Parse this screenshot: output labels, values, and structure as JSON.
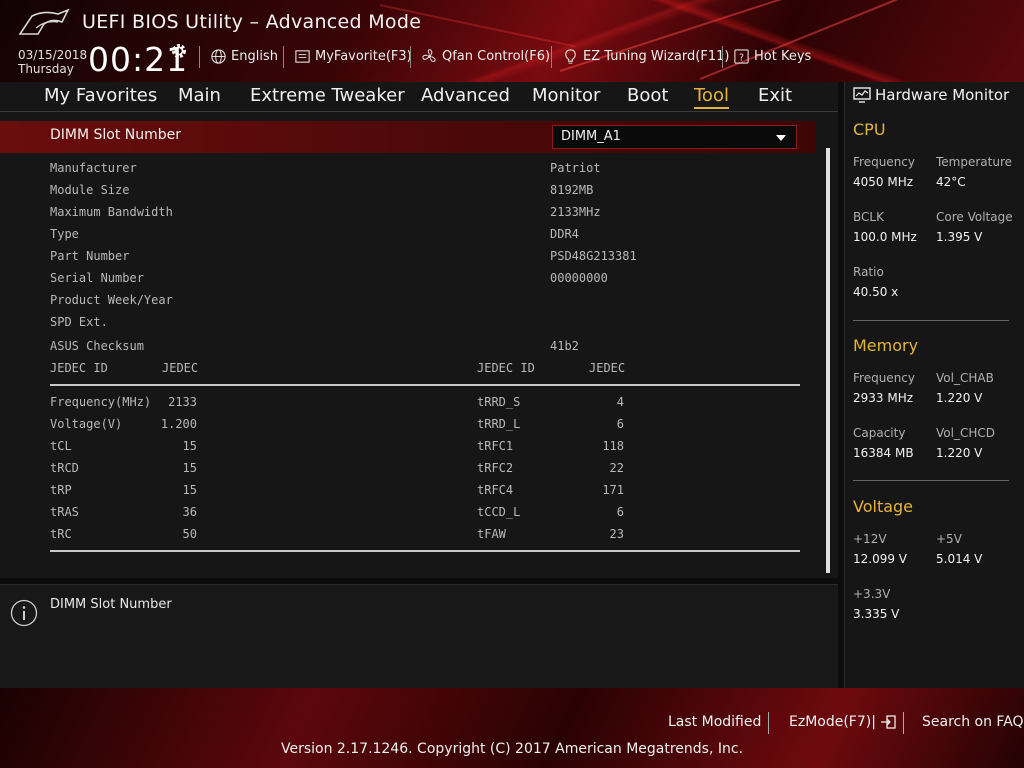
{
  "app": {
    "title": "UEFI BIOS Utility – Advanced Mode"
  },
  "clock": {
    "date": "03/15/2018",
    "day": "Thursday",
    "time": "00:21"
  },
  "toolbar": {
    "language": "English",
    "favorite": "MyFavorite(F3)",
    "qfan": "Qfan Control(F6)",
    "ez_tuning": "EZ Tuning Wizard(F11)",
    "hotkeys": "Hot Keys"
  },
  "menu": {
    "favorites": "My Favorites",
    "main": "Main",
    "extreme": "Extreme Tweaker",
    "advanced": "Advanced",
    "monitor": "Monitor",
    "boot": "Boot",
    "tool": "Tool",
    "exit": "Exit"
  },
  "slot": {
    "label": "DIMM Slot Number",
    "value": "DIMM_A1"
  },
  "info": [
    {
      "label": "Manufacturer",
      "value": "Patriot"
    },
    {
      "label": "Module Size",
      "value": "8192MB"
    },
    {
      "label": "Maximum Bandwidth",
      "value": "2133MHz"
    },
    {
      "label": "Type",
      "value": "DDR4"
    },
    {
      "label": "Part Number",
      "value": "PSD48G213381"
    },
    {
      "label": "Serial Number",
      "value": "00000000"
    },
    {
      "label": "Product Week/Year",
      "value": ""
    },
    {
      "label": "SPD Ext.",
      "value": ""
    },
    {
      "label": "ASUS Checksum",
      "value": "41b2"
    }
  ],
  "jedec": {
    "left_header": [
      "JEDEC ID",
      "JEDEC"
    ],
    "right_header": [
      "JEDEC ID",
      "JEDEC"
    ],
    "left": [
      {
        "name": "Frequency(MHz)",
        "value": "2133"
      },
      {
        "name": "Voltage(V)",
        "value": "1.200"
      },
      {
        "name": "tCL",
        "value": "15"
      },
      {
        "name": "tRCD",
        "value": "15"
      },
      {
        "name": "tRP",
        "value": "15"
      },
      {
        "name": "tRAS",
        "value": "36"
      },
      {
        "name": "tRC",
        "value": "50"
      }
    ],
    "right": [
      {
        "name": "tRRD_S",
        "value": "4"
      },
      {
        "name": "tRRD_L",
        "value": "6"
      },
      {
        "name": "tRFC1",
        "value": "118"
      },
      {
        "name": "tRFC2",
        "value": "22"
      },
      {
        "name": "tRFC4",
        "value": "171"
      },
      {
        "name": "tCCD_L",
        "value": "6"
      },
      {
        "name": "tFAW",
        "value": "23"
      }
    ]
  },
  "help": {
    "text": "DIMM Slot Number"
  },
  "hwmon": {
    "title": "Hardware Monitor",
    "cpu": {
      "title": "CPU",
      "frequency_label": "Frequency",
      "frequency": "4050 MHz",
      "temperature_label": "Temperature",
      "temperature": "42°C",
      "bclk_label": "BCLK",
      "bclk": "100.0 MHz",
      "core_voltage_label": "Core Voltage",
      "core_voltage": "1.395 V",
      "ratio_label": "Ratio",
      "ratio": "40.50 x"
    },
    "memory": {
      "title": "Memory",
      "frequency_label": "Frequency",
      "frequency": "2933 MHz",
      "vol_chab_label": "Vol_CHAB",
      "vol_chab": "1.220 V",
      "capacity_label": "Capacity",
      "capacity": "16384 MB",
      "vol_chcd_label": "Vol_CHCD",
      "vol_chcd": "1.220 V"
    },
    "voltage": {
      "title": "Voltage",
      "v12_label": "+12V",
      "v12": "12.099 V",
      "v5_label": "+5V",
      "v5": "5.014 V",
      "v33_label": "+3.3V",
      "v33": "3.335 V"
    }
  },
  "footer": {
    "last_modified": "Last Modified",
    "ezmode": "EzMode(F7)|",
    "search": "Search on FAQ",
    "copyright": "Version 2.17.1246. Copyright (C) 2017 American Megatrends, Inc."
  },
  "colors": {
    "accent": "#e6b33a",
    "brand_red": "#7a0b10",
    "panel": "#161616"
  }
}
